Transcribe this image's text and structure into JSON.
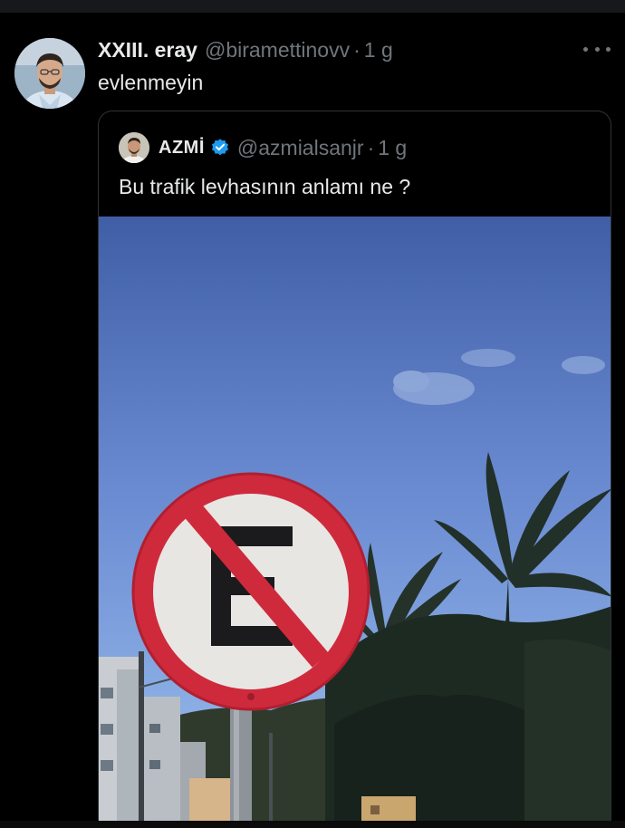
{
  "tweet": {
    "display_name": "XXIII. eray",
    "handle": "@biramettinovv",
    "separator": "·",
    "time": "1 g",
    "text": "evlenmeyin",
    "more_icon": "more-horizontal-icon"
  },
  "quoted_tweet": {
    "display_name": "AZMİ",
    "verified_icon": "verified-badge-icon",
    "handle": "@azmialsanjr",
    "separator": "·",
    "time": "1 g",
    "text": "Bu trafik levhasının anlamı ne ?",
    "media": {
      "description": "photo",
      "sign_letter": "E"
    }
  },
  "colors": {
    "background": "#000000",
    "primary_text": "#e7e9ea",
    "secondary_text": "#71767b",
    "border": "#2f3336",
    "verified_blue": "#1d9bf0",
    "sign_red": "#d0243b"
  }
}
